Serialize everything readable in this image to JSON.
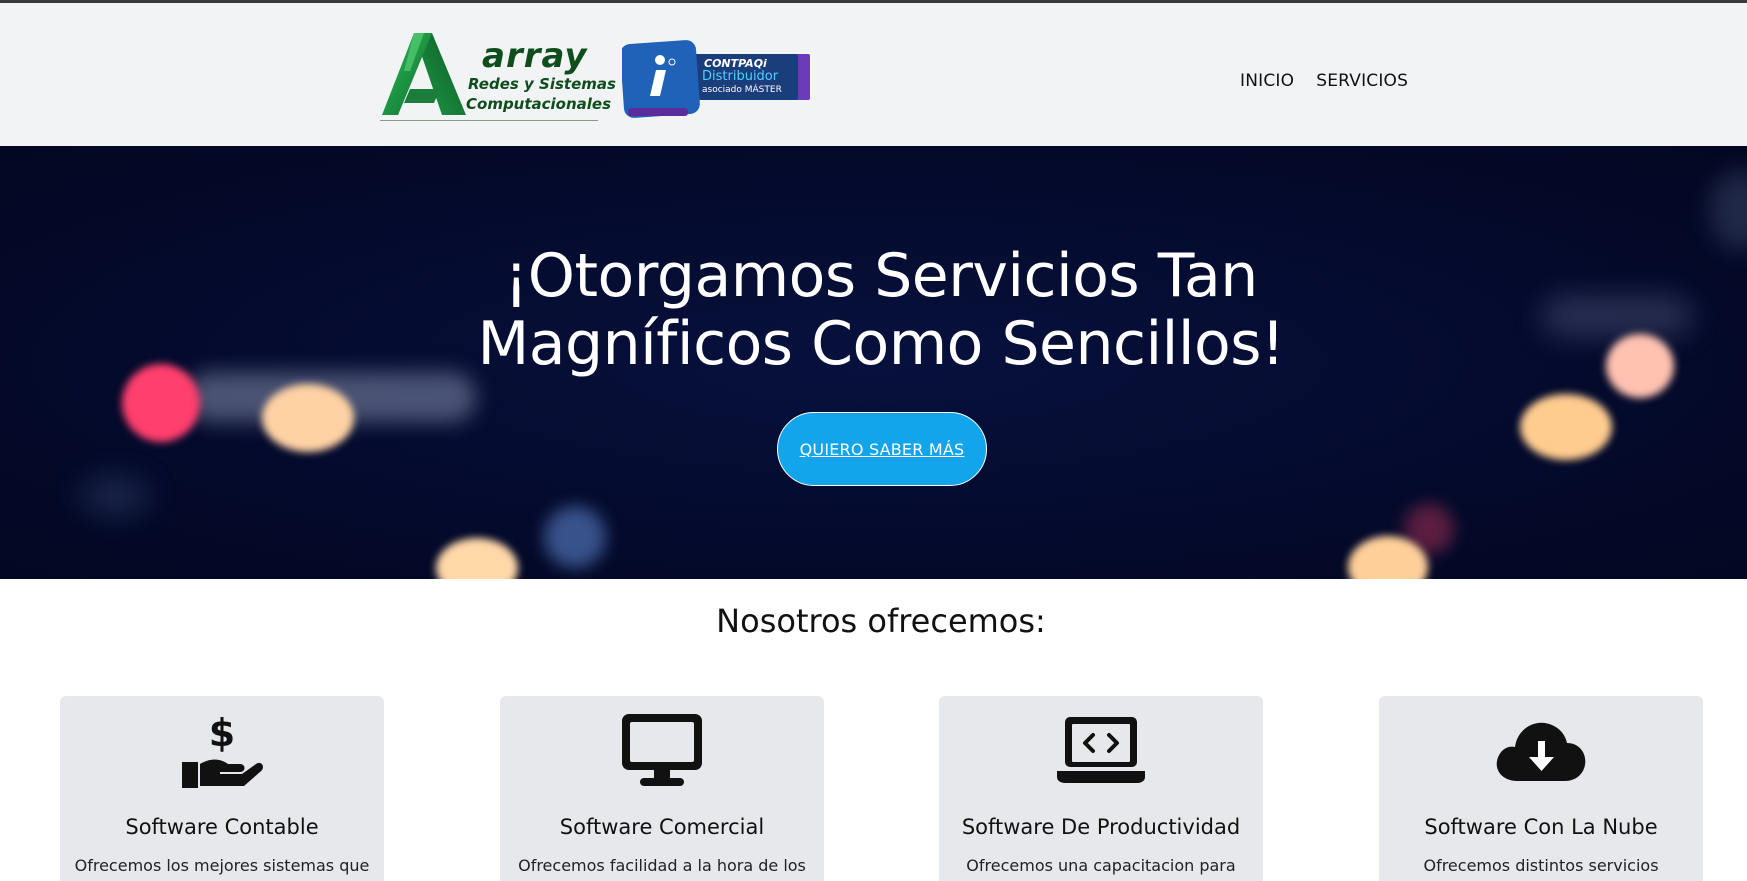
{
  "header": {
    "logo_array": {
      "brand": "array",
      "line1": "Redes y Sistemas",
      "line2": "Computacionales"
    },
    "logo_contpaqi": {
      "line1": "CONTPAQi",
      "line2": "Distribuidor",
      "line3": "asociado MÁSTER"
    },
    "nav": [
      {
        "label": "INICIO"
      },
      {
        "label": "SERVICIOS"
      }
    ]
  },
  "hero": {
    "title_line1": "¡Otorgamos Servicios Tan",
    "title_line2": "Magníficos Como Sencillos!",
    "cta_label": "QUIERO SABER MÁS"
  },
  "services": {
    "title": "Nosotros ofrecemos:",
    "items": [
      {
        "icon": "hand-dollar-icon",
        "title": "Software Contable",
        "desc": "Ofrecemos los mejores sistemas que"
      },
      {
        "icon": "desktop-icon",
        "title": "Software Comercial",
        "desc": "Ofrecemos facilidad a la hora de los"
      },
      {
        "icon": "laptop-code-icon",
        "title": "Software De Productividad",
        "desc": "Ofrecemos una capacitacion para"
      },
      {
        "icon": "cloud-download-icon",
        "title": "Software Con La Nube",
        "desc": "Ofrecemos distintos servicios"
      }
    ]
  },
  "colors": {
    "header_bg": "#f2f3f5",
    "hero_bg": "#040a2c",
    "cta": "#12a5ec",
    "card_bg": "#e7e8ec",
    "brand_green": "#0e4d1c",
    "contpaqi_blue": "#1f62b8"
  }
}
